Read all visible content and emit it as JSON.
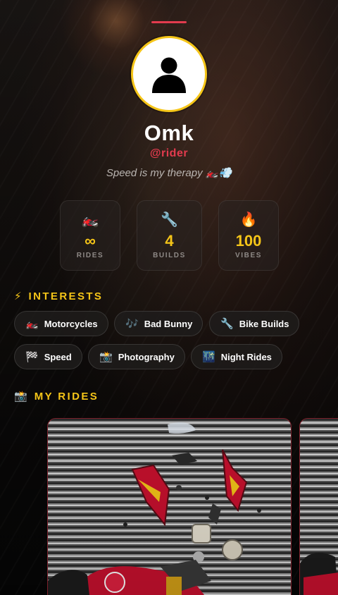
{
  "profile": {
    "name": "Omk",
    "handle": "@rider",
    "bio": "Speed is my therapy 🏍️💨"
  },
  "stats": [
    {
      "icon": "🏍️",
      "icon_name": "motorcycle-icon",
      "value": "∞",
      "label": "RIDES"
    },
    {
      "icon": "🔧",
      "icon_name": "wrench-icon",
      "value": "4",
      "label": "BUILDS"
    },
    {
      "icon": "🔥",
      "icon_name": "fire-icon",
      "value": "100",
      "label": "VIBES"
    }
  ],
  "interests": {
    "icon": "⚡",
    "title": "INTERESTS",
    "items": [
      {
        "icon": "🏍️",
        "label": "Motorcycles"
      },
      {
        "icon": "🎶",
        "label": "Bad Bunny"
      },
      {
        "icon": "🔧",
        "label": "Bike Builds"
      },
      {
        "icon": "🏁",
        "label": "Speed"
      },
      {
        "icon": "📸",
        "label": "Photography"
      },
      {
        "icon": "🌃",
        "label": "Night Rides"
      }
    ]
  },
  "rides": {
    "icon": "📸",
    "title": "MY RIDES"
  },
  "colors": {
    "accent_yellow": "#f5c518",
    "accent_red": "#e23b4e",
    "background": "#0b0b0c"
  }
}
